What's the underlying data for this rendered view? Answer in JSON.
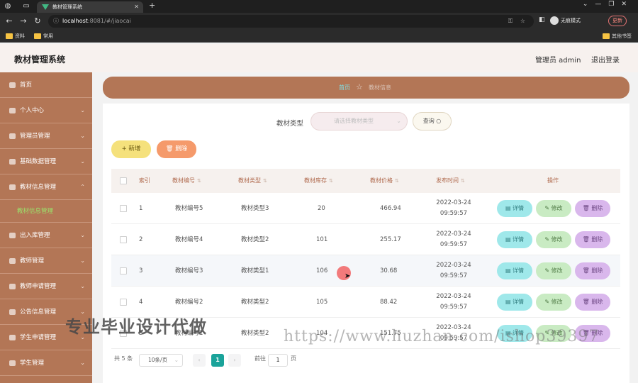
{
  "browser": {
    "tab_title": "教材管理系统",
    "url_host": "localhost",
    "url_path": ":8081/#/jiaocai",
    "incognito_label": "无痕模式",
    "update_label": "更新",
    "bookmarks": [
      "资料",
      "常用"
    ],
    "other_bookmarks": "其他书签"
  },
  "header": {
    "title": "教材管理系统",
    "user": "管理员 admin",
    "logout": "退出登录"
  },
  "sidebar": {
    "items": [
      "首页",
      "个人中心",
      "管理员管理",
      "基础数据管理",
      "教材信息管理",
      "出入库管理",
      "教师管理",
      "教师申请管理",
      "公告信息管理",
      "学生申请管理",
      "学生管理"
    ],
    "active_sub": "教材信息管理"
  },
  "breadcrumb": {
    "home": "首页",
    "current": "教材信息"
  },
  "search": {
    "label": "教材类型",
    "placeholder": "请选择教材类型",
    "button": "查询"
  },
  "actions": {
    "add": "+ 新增",
    "delete": "删除"
  },
  "table": {
    "columns": [
      "索引",
      "教材编号",
      "教材类型",
      "教材库存",
      "教材价格",
      "发布时间",
      "操作"
    ],
    "rows": [
      {
        "index": "1",
        "code": "教材编号5",
        "type": "教材类型3",
        "stock": "20",
        "price": "466.94",
        "date": "2022-03-24 09:59:57"
      },
      {
        "index": "2",
        "code": "教材编号4",
        "type": "教材类型2",
        "stock": "101",
        "price": "255.17",
        "date": "2022-03-24 09:59:57"
      },
      {
        "index": "3",
        "code": "教材编号3",
        "type": "教材类型1",
        "stock": "106",
        "price": "30.68",
        "date": "2022-03-24 09:59:57"
      },
      {
        "index": "4",
        "code": "教材编号2",
        "type": "教材类型2",
        "stock": "105",
        "price": "88.42",
        "date": "2022-03-24 09:59:57"
      },
      {
        "index": "5",
        "code": "教材编号1",
        "type": "教材类型2",
        "stock": "104",
        "price": "151.75",
        "date": "2022-03-24 09:59:57"
      }
    ],
    "row_buttons": {
      "detail": "详情",
      "edit": "修改",
      "remove": "删除"
    }
  },
  "pagination": {
    "total": "共 5 条",
    "page_size": "10条/页",
    "current_page": "1",
    "goto_label": "前往",
    "goto_value": "1",
    "page_suffix": "页"
  },
  "watermark": {
    "text1": "专业毕业设计代做",
    "text2": "https://www.huzhan.com/ishop39397"
  },
  "colors": {
    "sidebar": "#b37656",
    "active_page": "#1aa39a",
    "detail_button": "#9fe8ea",
    "edit_button": "#c9ebc3",
    "remove_button": "#d9b7ec"
  }
}
